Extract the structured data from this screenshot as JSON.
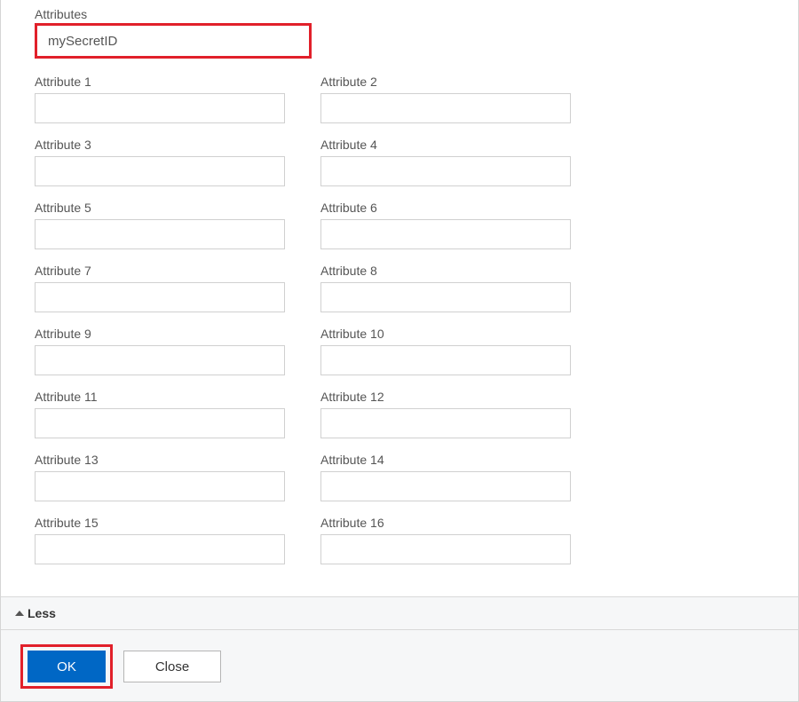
{
  "section": {
    "title": "Attributes",
    "primary_value": "mySecretID"
  },
  "attributes": [
    {
      "label": "Attribute 1",
      "value": ""
    },
    {
      "label": "Attribute 2",
      "value": ""
    },
    {
      "label": "Attribute 3",
      "value": ""
    },
    {
      "label": "Attribute 4",
      "value": ""
    },
    {
      "label": "Attribute 5",
      "value": ""
    },
    {
      "label": "Attribute 6",
      "value": ""
    },
    {
      "label": "Attribute 7",
      "value": ""
    },
    {
      "label": "Attribute 8",
      "value": ""
    },
    {
      "label": "Attribute 9",
      "value": ""
    },
    {
      "label": "Attribute 10",
      "value": ""
    },
    {
      "label": "Attribute 11",
      "value": ""
    },
    {
      "label": "Attribute 12",
      "value": ""
    },
    {
      "label": "Attribute 13",
      "value": ""
    },
    {
      "label": "Attribute 14",
      "value": ""
    },
    {
      "label": "Attribute 15",
      "value": ""
    },
    {
      "label": "Attribute 16",
      "value": ""
    }
  ],
  "toggle": {
    "label": "Less"
  },
  "buttons": {
    "ok_label": "OK",
    "close_label": "Close"
  }
}
